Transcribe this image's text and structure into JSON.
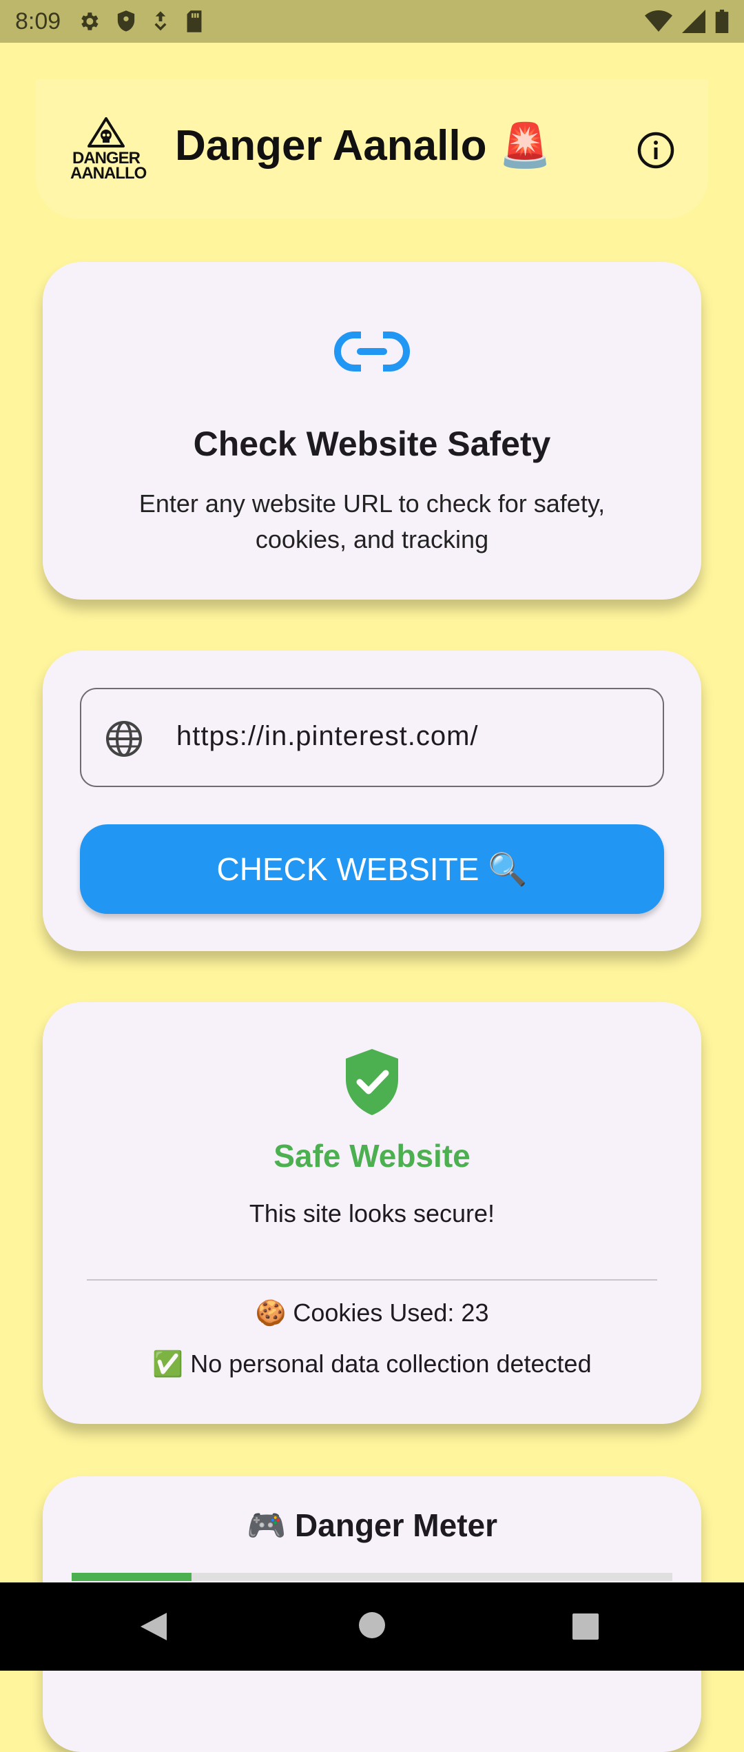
{
  "status_bar": {
    "time": "8:09",
    "left_icons": [
      "settings-icon",
      "shield-icon",
      "download-icon",
      "sd-card-icon"
    ],
    "right_icons": [
      "wifi-icon",
      "cell-signal-icon",
      "battery-icon"
    ]
  },
  "app_bar": {
    "logo_line1": "DANGER",
    "logo_line2": "AANALLO",
    "title": "Danger Aanallo 🚨",
    "info_icon": "info-icon"
  },
  "intro_card": {
    "icon": "link-icon",
    "title": "Check Website Safety",
    "description": "Enter any website URL to check for safety, cookies, and tracking"
  },
  "input_card": {
    "url_value": "https://in.pinterest.com/",
    "globe_icon": "globe-icon",
    "check_button_label": "CHECK WEBSITE 🔍"
  },
  "result_card": {
    "icon": "shield-check-icon",
    "status_title": "Safe Website",
    "status_message": "This site looks secure!",
    "cookies_text": "🍪 Cookies Used: 23",
    "privacy_text": "✅ No personal data collection detected",
    "accent_color": "#4caf50"
  },
  "meter_card": {
    "title": "🎮 Danger Meter",
    "level_fraction": 0.2
  },
  "colors": {
    "background": "#fff59d",
    "primary": "#2196f3",
    "safe": "#4caf50"
  },
  "nav_bar": {
    "buttons": [
      "back-icon",
      "home-icon",
      "recents-icon"
    ]
  }
}
